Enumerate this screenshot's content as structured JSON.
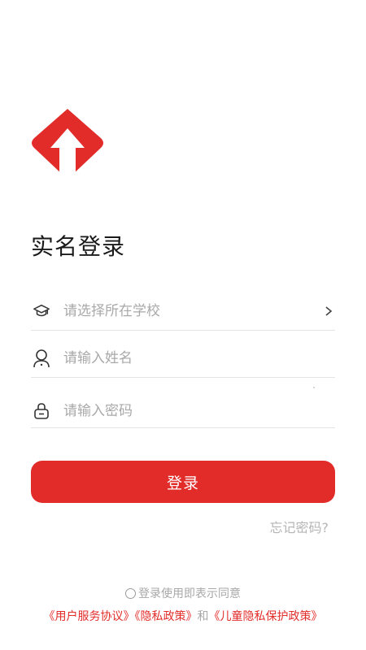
{
  "page": {
    "title": "实名登录"
  },
  "form": {
    "school": {
      "placeholder": "请选择所在学校",
      "icon": "graduation-cap-icon"
    },
    "name": {
      "placeholder": "请输入姓名",
      "icon": "user-icon"
    },
    "password": {
      "placeholder": "请输入密码",
      "icon": "lock-icon"
    }
  },
  "actions": {
    "login_label": "登录",
    "forgot_label": "忘记密码?"
  },
  "agreement": {
    "consent_text": "登录使用即表示同意",
    "user_agreement": "《用户服务协议》",
    "privacy_policy": "《隐私政策》",
    "conjunction": "和",
    "child_privacy": "《儿童隐私保护政策》"
  },
  "colors": {
    "brand": "#e22c29",
    "placeholder": "#a9a9a9",
    "divider": "#e4e4e4"
  }
}
